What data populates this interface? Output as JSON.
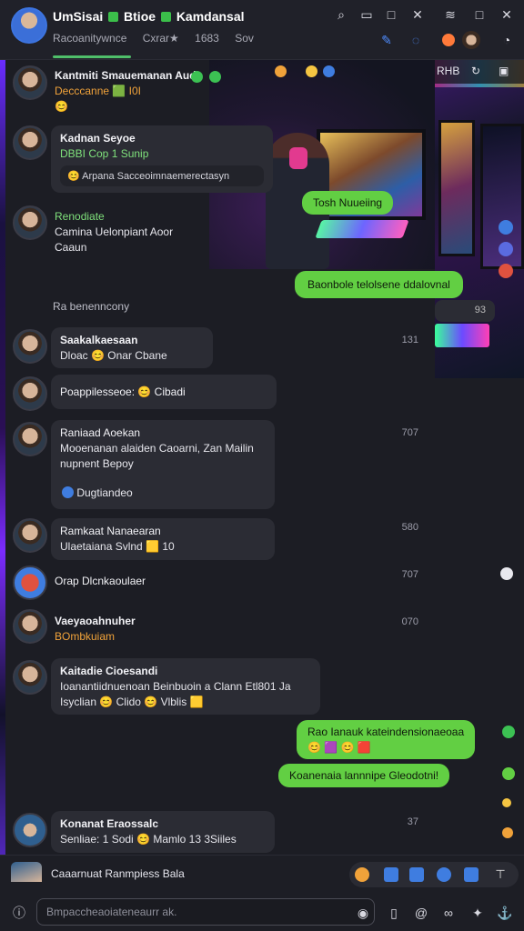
{
  "header": {
    "title_part1": "UmSisai",
    "title_part2": "Btioe",
    "title_part3": "Kamdansal",
    "subtitle": [
      "Racoanitywnce",
      "Cxrar★",
      "1683",
      "Sov"
    ]
  },
  "image_panel_header": {
    "label": "RHB"
  },
  "messages": [
    {
      "sender": "Kantmiti Smauemanan Auds",
      "lines": [
        "Decccanne 🟩 I0I",
        "😊"
      ],
      "time": ""
    },
    {
      "sender": "Kadnan Seyoe",
      "lines": [
        "DBBI Cop 1 Sunip"
      ],
      "quote": "😊 Arpana Sacceoimnaemerectasyn",
      "time": ""
    },
    {
      "sender": "Renodiate",
      "lines": [
        "Camina Uelonpiant Aoor",
        "Caaun"
      ],
      "time": ""
    },
    {
      "sender": "Saakalkaesaan",
      "lines": [
        "Dloac 😊 Onar Cbane"
      ],
      "time": "131"
    },
    {
      "sender": "Poappilesseoe: 😊 Cibadi",
      "lines": [],
      "time": ""
    },
    {
      "sender": "Raniaad Aoekan",
      "lines": [
        "Mooenanan alaiden Caoarni, Zan Mailin",
        "nupnent Bepoy"
      ],
      "quote": "Dugtiandeo",
      "time": "707"
    },
    {
      "sender": "Ramkaat Nanaearan",
      "lines": [
        "Ulaetaiana Svlnd 🟨 10"
      ],
      "time": "580"
    },
    {
      "sender": "Orap Dlcnkaoulaer",
      "lines": [],
      "time": "707"
    },
    {
      "sender": "Vaeyaoahnuher",
      "lines": [
        "BOmbkuiam"
      ],
      "time": "070"
    },
    {
      "sender": "Kaitadie Cioesandi",
      "lines": [
        "Ioanantiidnuenoan Beinbuoin a Clann Etl801 Ja",
        "Isyclian 😊 Clido 😊 Vlblis 🟨"
      ],
      "time": ""
    },
    {
      "sender": "Konanat Eraossalc",
      "lines": [
        "Senliae: 1 Sodi 😊 Mamlo 13 3Siiles"
      ],
      "time": "37"
    }
  ],
  "date_separator": "Ra benenncony",
  "outgoing": [
    {
      "text": "Tosh Nuueiing"
    },
    {
      "text": "Baonbole telolsene ddalovnal"
    },
    {
      "text": "Rao Ianauk kateindensionaeoaa",
      "sub": "😊 🟪 😊 🟥"
    },
    {
      "text": "Koanenaia lannnipe Gleodotni!"
    }
  ],
  "outgoing_meta": "93",
  "reply_preview": "Caaarnuat Ranmpiess Bala",
  "composer": {
    "placeholder": "Bmpaccheaoiateneaurr ak."
  },
  "colors": {
    "accent_green": "#62cf43",
    "accent_blue": "#4f8dff",
    "bg": "#1c1d24"
  },
  "icons": [
    "search-icon",
    "window-icon",
    "close-icon",
    "wifi-icon",
    "restore-icon",
    "pen-icon",
    "emoji-icon",
    "attach-icon",
    "send-icon"
  ]
}
